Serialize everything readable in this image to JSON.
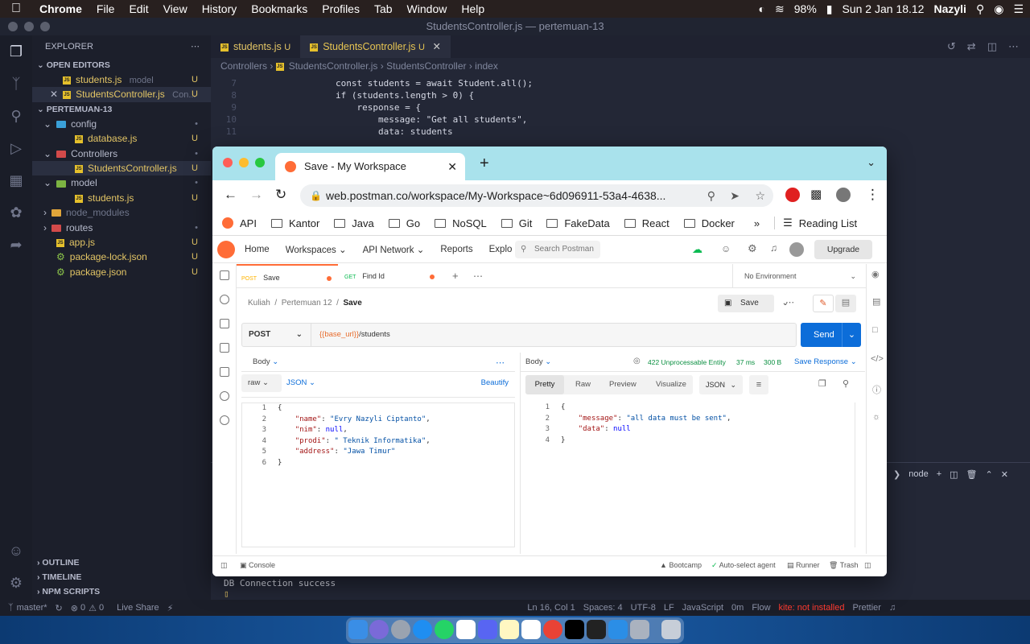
{
  "menubar": {
    "app": "Chrome",
    "items": [
      "File",
      "Edit",
      "View",
      "History",
      "Bookmarks",
      "Profiles",
      "Tab",
      "Window",
      "Help"
    ],
    "battery": "98%",
    "datetime": "Sun 2 Jan  18.12",
    "user": "Nazyli"
  },
  "vscode": {
    "title": "StudentsController.js — pertemuan-13",
    "explorer_title": "EXPLORER",
    "open_editors": "OPEN EDITORS",
    "open_files": [
      {
        "name": "students.js",
        "desc": "model",
        "mark": "U"
      },
      {
        "name": "StudentsController.js",
        "desc": "Con...",
        "mark": "U"
      }
    ],
    "project": "PERTEMUAN-13",
    "tree": [
      {
        "name": "config",
        "type": "folder",
        "indent": 1,
        "mark": "•"
      },
      {
        "name": "database.js",
        "type": "js",
        "indent": 2,
        "mark": "U"
      },
      {
        "name": "Controllers",
        "type": "folder",
        "indent": 1,
        "mark": "•"
      },
      {
        "name": "StudentsController.js",
        "type": "js",
        "indent": 2,
        "mark": "U"
      },
      {
        "name": "model",
        "type": "folder",
        "indent": 1,
        "mark": "•"
      },
      {
        "name": "students.js",
        "type": "js",
        "indent": 2,
        "mark": "U"
      },
      {
        "name": "node_modules",
        "type": "folder-c",
        "indent": 1,
        "mark": ""
      },
      {
        "name": "routes",
        "type": "folder-c",
        "indent": 1,
        "mark": "•"
      },
      {
        "name": "app.js",
        "type": "js",
        "indent": 1,
        "mark": "U"
      },
      {
        "name": "package-lock.json",
        "type": "json",
        "indent": 1,
        "mark": "U"
      },
      {
        "name": "package.json",
        "type": "json",
        "indent": 1,
        "mark": "U"
      }
    ],
    "outline": "OUTLINE",
    "timeline": "TIMELINE",
    "npm_scripts": "NPM SCRIPTS",
    "tabs": [
      {
        "name": "students.js",
        "mark": "U"
      },
      {
        "name": "StudentsController.js",
        "mark": "U"
      }
    ],
    "breadcrumb": [
      "Controllers",
      "StudentsController.js",
      "StudentsController",
      "index"
    ],
    "code": [
      {
        "n": "7",
        "t": "        const students = await Student.all();"
      },
      {
        "n": "8",
        "t": "        if (students.length > 0) {"
      },
      {
        "n": "9",
        "t": "            response = {"
      },
      {
        "n": "10",
        "t": "                message: \"Get all students\","
      },
      {
        "n": "11",
        "t": "                data: students"
      }
    ],
    "terminal_label": "node",
    "terminal_text": "DB Connection success",
    "status": {
      "branch": "master*",
      "errors": "0",
      "warnings": "0",
      "live_share": "Live Share",
      "position": "Ln 16, Col 1",
      "spaces": "Spaces: 4",
      "encoding": "UTF-8",
      "eol": "LF",
      "lang": "JavaScript",
      "time": "0m",
      "flow": "Flow",
      "kite": "kite: not installed",
      "prettier": "Prettier"
    }
  },
  "chrome": {
    "tab_title": "Save - My Workspace",
    "url": "web.postman.co/workspace/My-Workspace~6d096911-53a4-4638...",
    "bookmarks": [
      "API",
      "Kantor",
      "Java",
      "Go",
      "NoSQL",
      "Git",
      "FakeData",
      "React",
      "Docker"
    ],
    "reading_list": "Reading List"
  },
  "postman": {
    "nav": [
      "Home",
      "Workspaces",
      "API Network",
      "Reports",
      "Explo"
    ],
    "search_placeholder": "Search Postman",
    "upgrade": "Upgrade",
    "environment": "No Environment",
    "tabs": [
      {
        "method": "POST",
        "name": "Save"
      },
      {
        "method": "GET",
        "name": "Find Id"
      }
    ],
    "breadcrumb": [
      "Kuliah",
      "Pertemuan 12",
      "Save"
    ],
    "save_label": "Save",
    "method": "POST",
    "url_var": "{{base_url}}",
    "url_path": "/students",
    "send": "Send",
    "body_label": "Body",
    "raw": "raw",
    "json": "JSON",
    "beautify": "Beautify",
    "request_lines": [
      {
        "n": "1",
        "t": "{"
      },
      {
        "n": "2",
        "k": "\"name\"",
        "v": "\"Evry Nazyli Ciptanto\"",
        "c": ","
      },
      {
        "n": "3",
        "k": "\"nim\"",
        "v": "null",
        "c": ","
      },
      {
        "n": "4",
        "k": "\"prodi\"",
        "v": "\" Teknik Informatika\"",
        "c": ","
      },
      {
        "n": "5",
        "k": "\"address\"",
        "v": "\"Jawa Timur\"",
        "c": ""
      },
      {
        "n": "6",
        "t": "}"
      }
    ],
    "response": {
      "body_label": "Body",
      "status": "422 Unprocessable Entity",
      "time": "37 ms",
      "size": "300 B",
      "save_response": "Save Response",
      "views": [
        "Pretty",
        "Raw",
        "Preview",
        "Visualize"
      ],
      "format": "JSON",
      "lines": [
        {
          "n": "1",
          "t": "{"
        },
        {
          "n": "2",
          "k": "\"message\"",
          "v": "\"all data must be sent\"",
          "c": ","
        },
        {
          "n": "3",
          "k": "\"data\"",
          "v": "null",
          "c": ""
        },
        {
          "n": "4",
          "t": "}"
        }
      ]
    },
    "footer": {
      "console": "Console",
      "bootcamp": "Bootcamp",
      "agent": "Auto-select agent",
      "runner": "Runner",
      "trash": "Trash"
    }
  }
}
